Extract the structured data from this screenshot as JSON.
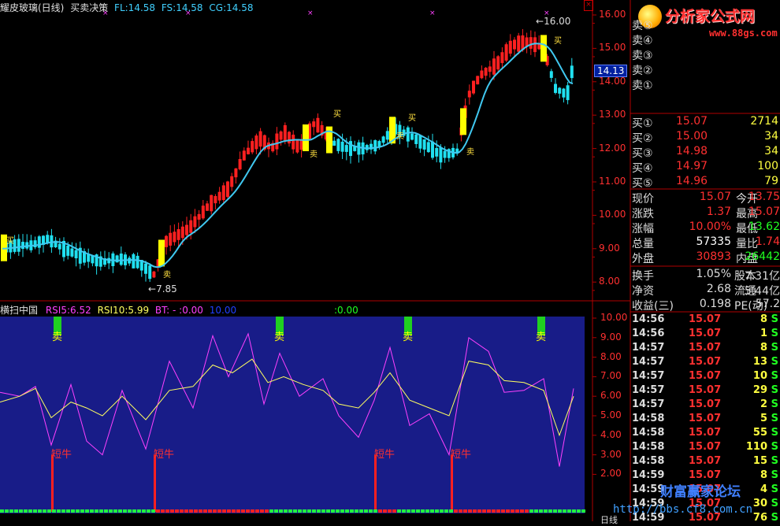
{
  "header": {
    "title": "耀皮玻璃(日线)",
    "indicator": "买卖决策",
    "fl": "FL:14.58",
    "fs": "FS:14.58",
    "cg": "CG:14.58"
  },
  "main_chart": {
    "price_labels": [
      "16.00",
      "15.00",
      "14.00",
      "13.00",
      "12.00",
      "11.00",
      "10.00",
      "9.00",
      "8.00"
    ],
    "current_price_tag": "14.13",
    "high_marker": "16.00",
    "low_marker": "7.85",
    "buy_marker": "买",
    "sell_marker": "卖",
    "colors": {
      "up": "#ff2020",
      "down": "#20e0f0",
      "signal": "#ffff00",
      "ma": "#40c8f0"
    }
  },
  "sub_chart": {
    "title": "横扫中国",
    "rsi5": "RSI5:6.52",
    "rsi10": "RSI10:5.99",
    "bt": "BT: -  :0.00",
    "bt_val": "10.00",
    "extra": ":0.00",
    "labels": [
      "10.00",
      "9.00",
      "8.00",
      "7.00",
      "6.00",
      "5.00",
      "4.00",
      "3.00",
      "2.00"
    ],
    "short_bull": "短牛",
    "sell": "卖",
    "bottom_right": "日线"
  },
  "logo": {
    "brand": "分析家公式网",
    "url": "www.88gs.com"
  },
  "watermark_bottom": {
    "forum": "财富赢家论坛",
    "url": "http://bbs.cf8.com.cn"
  },
  "order_book": {
    "sell": [
      {
        "label": "卖⑤",
        "price": "",
        "vol": ""
      },
      {
        "label": "卖④",
        "price": "",
        "vol": ""
      },
      {
        "label": "卖③",
        "price": "",
        "vol": ""
      },
      {
        "label": "卖②",
        "price": "",
        "vol": ""
      },
      {
        "label": "卖①",
        "price": "",
        "vol": ""
      }
    ],
    "buy": [
      {
        "label": "买①",
        "price": "15.07",
        "vol": "2714"
      },
      {
        "label": "买②",
        "price": "15.00",
        "vol": "34"
      },
      {
        "label": "买③",
        "price": "14.98",
        "vol": "34"
      },
      {
        "label": "买④",
        "price": "14.97",
        "vol": "100"
      },
      {
        "label": "买⑤",
        "price": "14.96",
        "vol": "79"
      }
    ]
  },
  "quote": [
    {
      "l1": "现价",
      "v1": "15.07",
      "l2": "今开",
      "v2": "13.75",
      "c1": "#ff3030",
      "c2": "#ff3030"
    },
    {
      "l1": "涨跌",
      "v1": "1.37",
      "l2": "最高",
      "v2": "15.07",
      "c1": "#ff3030",
      "c2": "#ff3030"
    },
    {
      "l1": "涨幅",
      "v1": "10.00%",
      "l2": "最低",
      "v2": "13.62",
      "c1": "#ff3030",
      "c2": "#20ff20"
    },
    {
      "l1": "总量",
      "v1": "57335",
      "l2": "量比",
      "v2": "1.74",
      "c1": "#ffffff",
      "c2": "#ff3030"
    },
    {
      "l1": "外盘",
      "v1": "30893",
      "l2": "内盘",
      "v2": "26442",
      "c1": "#ff3030",
      "c2": "#20ff20"
    }
  ],
  "fundamentals": [
    {
      "l1": "换手",
      "v1": "1.05%",
      "l2": "股本",
      "v2": "7.31亿"
    },
    {
      "l1": "净资",
      "v1": "2.68",
      "l2": "流通",
      "v2": "5.44亿"
    },
    {
      "l1": "收益(三)",
      "v1": "0.198",
      "l2": "PE(动)",
      "v2": "57.2"
    }
  ],
  "ticks": [
    {
      "time": "14:56",
      "price": "15.07",
      "vol": "8",
      "side": "S"
    },
    {
      "time": "14:56",
      "price": "15.07",
      "vol": "1",
      "side": "S"
    },
    {
      "time": "14:57",
      "price": "15.07",
      "vol": "8",
      "side": "S"
    },
    {
      "time": "14:57",
      "price": "15.07",
      "vol": "13",
      "side": "S"
    },
    {
      "time": "14:57",
      "price": "15.07",
      "vol": "10",
      "side": "S"
    },
    {
      "time": "14:57",
      "price": "15.07",
      "vol": "29",
      "side": "S"
    },
    {
      "time": "14:57",
      "price": "15.07",
      "vol": "2",
      "side": "S"
    },
    {
      "time": "14:58",
      "price": "15.07",
      "vol": "5",
      "side": "S"
    },
    {
      "time": "14:58",
      "price": "15.07",
      "vol": "55",
      "side": "S"
    },
    {
      "time": "14:58",
      "price": "15.07",
      "vol": "110",
      "side": "S"
    },
    {
      "time": "14:58",
      "price": "15.07",
      "vol": "15",
      "side": "S"
    },
    {
      "time": "14:59",
      "price": "15.07",
      "vol": "8",
      "side": "S"
    },
    {
      "time": "14:59",
      "price": "15.07",
      "vol": "4",
      "side": "S"
    },
    {
      "time": "14:59",
      "price": "15.07",
      "vol": "30",
      "side": "S"
    },
    {
      "time": "14:59",
      "price": "15.07",
      "vol": "76",
      "side": "S"
    }
  ]
}
